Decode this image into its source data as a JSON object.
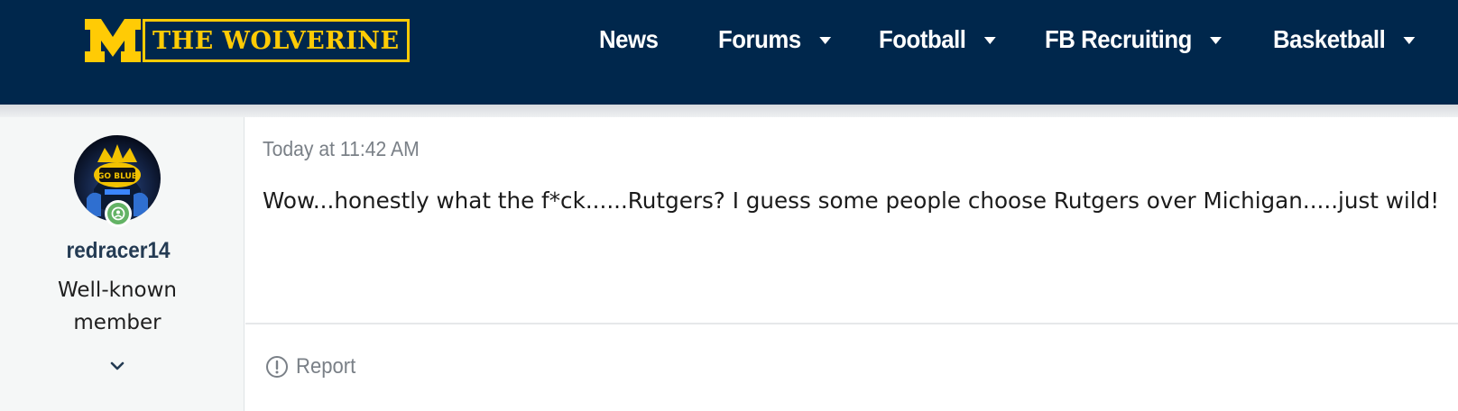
{
  "header": {
    "logo_text": "THE WOLVERINE",
    "logo_letter": "M",
    "nav": [
      {
        "label": "News",
        "has_dropdown": false
      },
      {
        "label": "Forums",
        "has_dropdown": true
      },
      {
        "label": "Football",
        "has_dropdown": true
      },
      {
        "label": "FB Recruiting",
        "has_dropdown": true
      },
      {
        "label": "Basketball",
        "has_dropdown": true
      }
    ],
    "bg_color": "#00274c",
    "accent_color": "#ffcb05"
  },
  "post": {
    "user": {
      "username": "redracer14",
      "title": "Well-known member",
      "avatar_text": "GO BLUE",
      "status": "online"
    },
    "timestamp": "Today at 11:42 AM",
    "message": "Wow...honestly what the f*ck......Rutgers? I guess some people choose Rutgers over Michigan.....just wild!",
    "actions": {
      "report_label": "Report"
    }
  },
  "icons": [
    "m-logo-icon",
    "online-status-icon",
    "chevron-down-icon",
    "report-alert-icon",
    "dropdown-caret-icon"
  ]
}
